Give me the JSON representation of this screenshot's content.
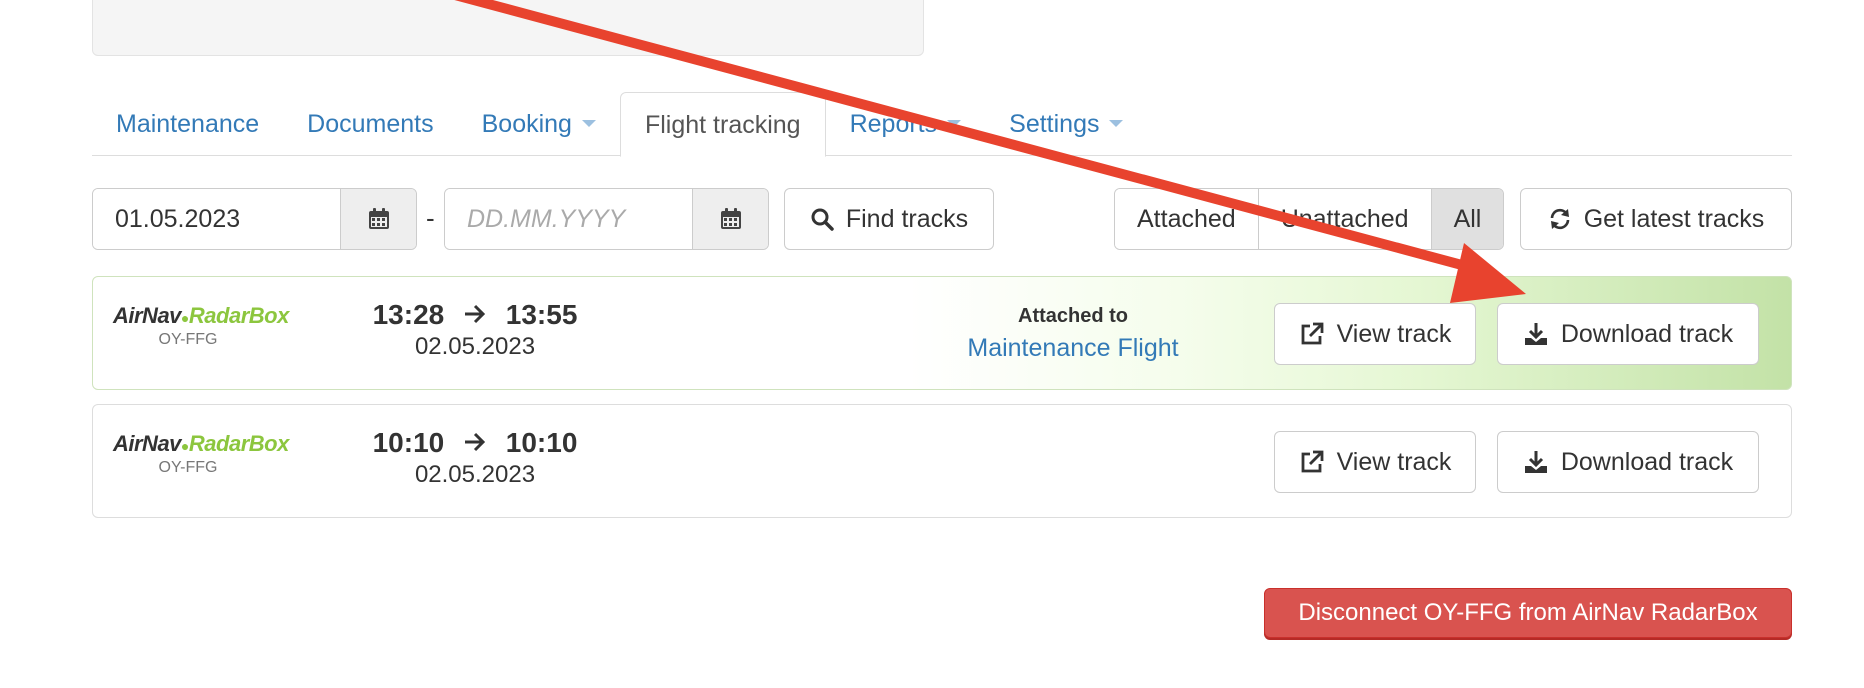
{
  "tabs": [
    {
      "label": "Maintenance",
      "dropdown": false,
      "active": false
    },
    {
      "label": "Documents",
      "dropdown": false,
      "active": false
    },
    {
      "label": "Booking",
      "dropdown": true,
      "active": false
    },
    {
      "label": "Flight tracking",
      "dropdown": false,
      "active": true
    },
    {
      "label": "Reports",
      "dropdown": true,
      "active": false
    },
    {
      "label": "Settings",
      "dropdown": true,
      "active": false
    }
  ],
  "filters": {
    "date_from": {
      "value": "01.05.2023",
      "placeholder": ""
    },
    "separator": "-",
    "date_to": {
      "value": "",
      "placeholder": "DD.MM.YYYY"
    },
    "find_label": "Find tracks",
    "segment": [
      "Attached",
      "Unattached",
      "All"
    ],
    "segment_selected": "All",
    "latest_label": "Get latest tracks"
  },
  "provider": {
    "name_part1": "AirNav",
    "dot": "●",
    "name_part2": "RadarBox"
  },
  "tracks": [
    {
      "registration": "OY-FFG",
      "start": "13:28",
      "end": "13:55",
      "date": "02.05.2023",
      "attached_label": "Attached to",
      "attached_link": "Maintenance Flight",
      "view_label": "View track",
      "download_label": "Download track"
    },
    {
      "registration": "OY-FFG",
      "start": "10:10",
      "end": "10:10",
      "date": "02.05.2023",
      "view_label": "View track",
      "download_label": "Download track"
    }
  ],
  "disconnect_label": "Disconnect OY-FFG from AirNav RadarBox",
  "colors": {
    "link": "#337ab7",
    "danger": "#d9534f",
    "annotation_arrow": "#e8432e",
    "brand_green": "#8cc63e"
  },
  "icons": [
    "calendar-icon",
    "search-icon",
    "refresh-icon",
    "arrow-right-icon",
    "external-link-icon",
    "download-icon"
  ]
}
